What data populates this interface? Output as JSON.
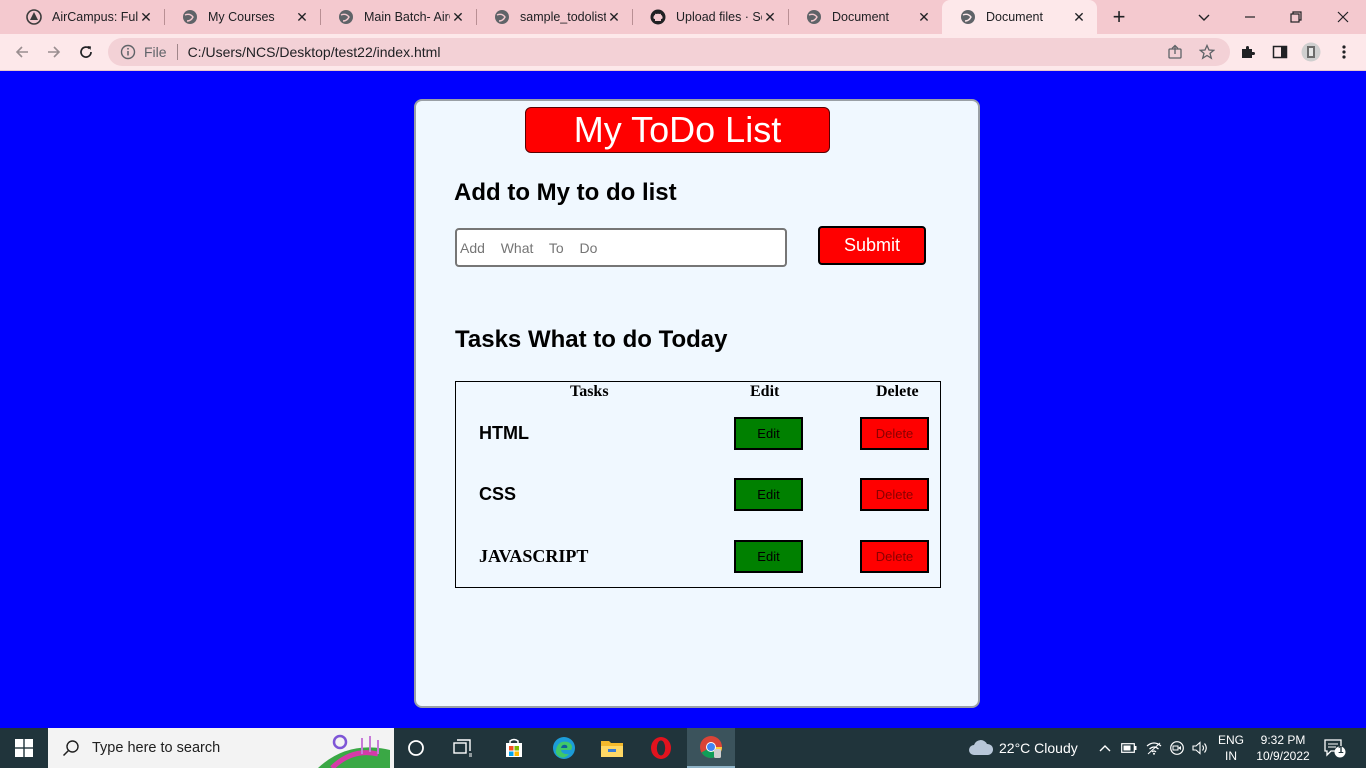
{
  "browser": {
    "tabs": [
      {
        "title": "AirCampus: Full S",
        "icon": "aircampus-icon",
        "active": false
      },
      {
        "title": "My Courses",
        "icon": "globe-icon",
        "active": false
      },
      {
        "title": "Main Batch- AirC",
        "icon": "globe-icon",
        "active": false
      },
      {
        "title": "sample_todolist.j",
        "icon": "globe-icon",
        "active": false
      },
      {
        "title": "Upload files · Sor",
        "icon": "github-icon",
        "active": false
      },
      {
        "title": "Document",
        "icon": "globe-icon",
        "active": false
      },
      {
        "title": "Document",
        "icon": "globe-icon",
        "active": true
      }
    ],
    "address": {
      "scheme_label": "File",
      "url": "C:/Users/NCS/Desktop/test22/index.html"
    }
  },
  "page": {
    "heading": "My ToDo List",
    "add_title": "Add to My to do list",
    "input": {
      "placeholder": "Add  What  To  Do",
      "value": ""
    },
    "submit_label": "Submit",
    "tasks_title": "Tasks What to do Today",
    "table": {
      "headers": {
        "tasks": "Tasks",
        "edit": "Edit",
        "delete": "Delete"
      },
      "rows": [
        {
          "task": "HTML",
          "edit": "Edit",
          "delete": "Delete"
        },
        {
          "task": "CSS",
          "edit": "Edit",
          "delete": "Delete"
        },
        {
          "task": "JAVASCRIPT",
          "edit": "Edit",
          "delete": "Delete"
        }
      ]
    }
  },
  "taskbar": {
    "search_placeholder": "Type here to search",
    "weather": "22°C  Cloudy",
    "language": {
      "line1": "ENG",
      "line2": "IN"
    },
    "clock": {
      "time": "9:32 PM",
      "date": "10/9/2022"
    },
    "notification_count": "1"
  },
  "colors": {
    "page_bg": "#0000ff",
    "card_bg": "#f0f8ff",
    "heading_bg": "#ff0000",
    "edit_bg": "#008000",
    "delete_bg": "#ff0000",
    "tabbar_bg": "#f4c9cf"
  }
}
